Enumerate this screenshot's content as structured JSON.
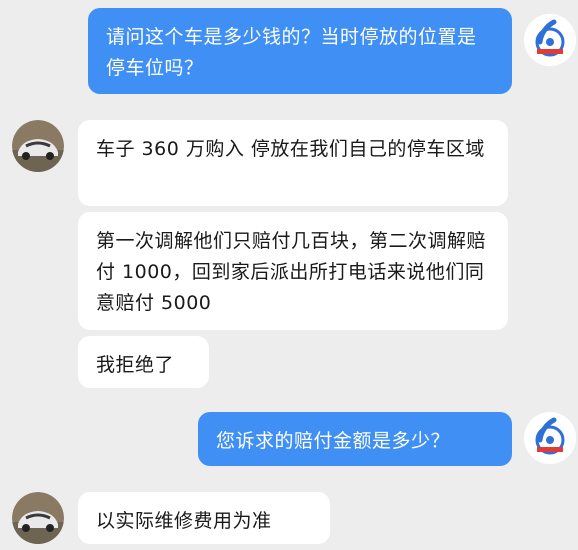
{
  "messages": [
    {
      "side": "out",
      "text": "请问这个车是多少钱的？当时停放的位置是停车位吗？"
    },
    {
      "side": "in",
      "text": "车子 360 万购入 停放在我们自己的停车区域"
    },
    {
      "side": "in",
      "text": "第一次调解他们只赔付几百块，第二次调解赔付 1000，回到家后派出所打电话来说他们同意赔付 5000"
    },
    {
      "side": "in",
      "text": "我拒绝了"
    },
    {
      "side": "out",
      "text": "您诉求的赔付金额是多少？"
    },
    {
      "side": "in",
      "text": "以实际维修费用为准"
    }
  ],
  "avatars": {
    "agent": {
      "icon": "media-logo-icon",
      "color": "#2e6fd8"
    },
    "user": {
      "icon": "car-photo-icon"
    }
  },
  "colors": {
    "background": "#ededed",
    "outgoing_bubble": "#3f8ff4",
    "incoming_bubble": "#ffffff"
  }
}
